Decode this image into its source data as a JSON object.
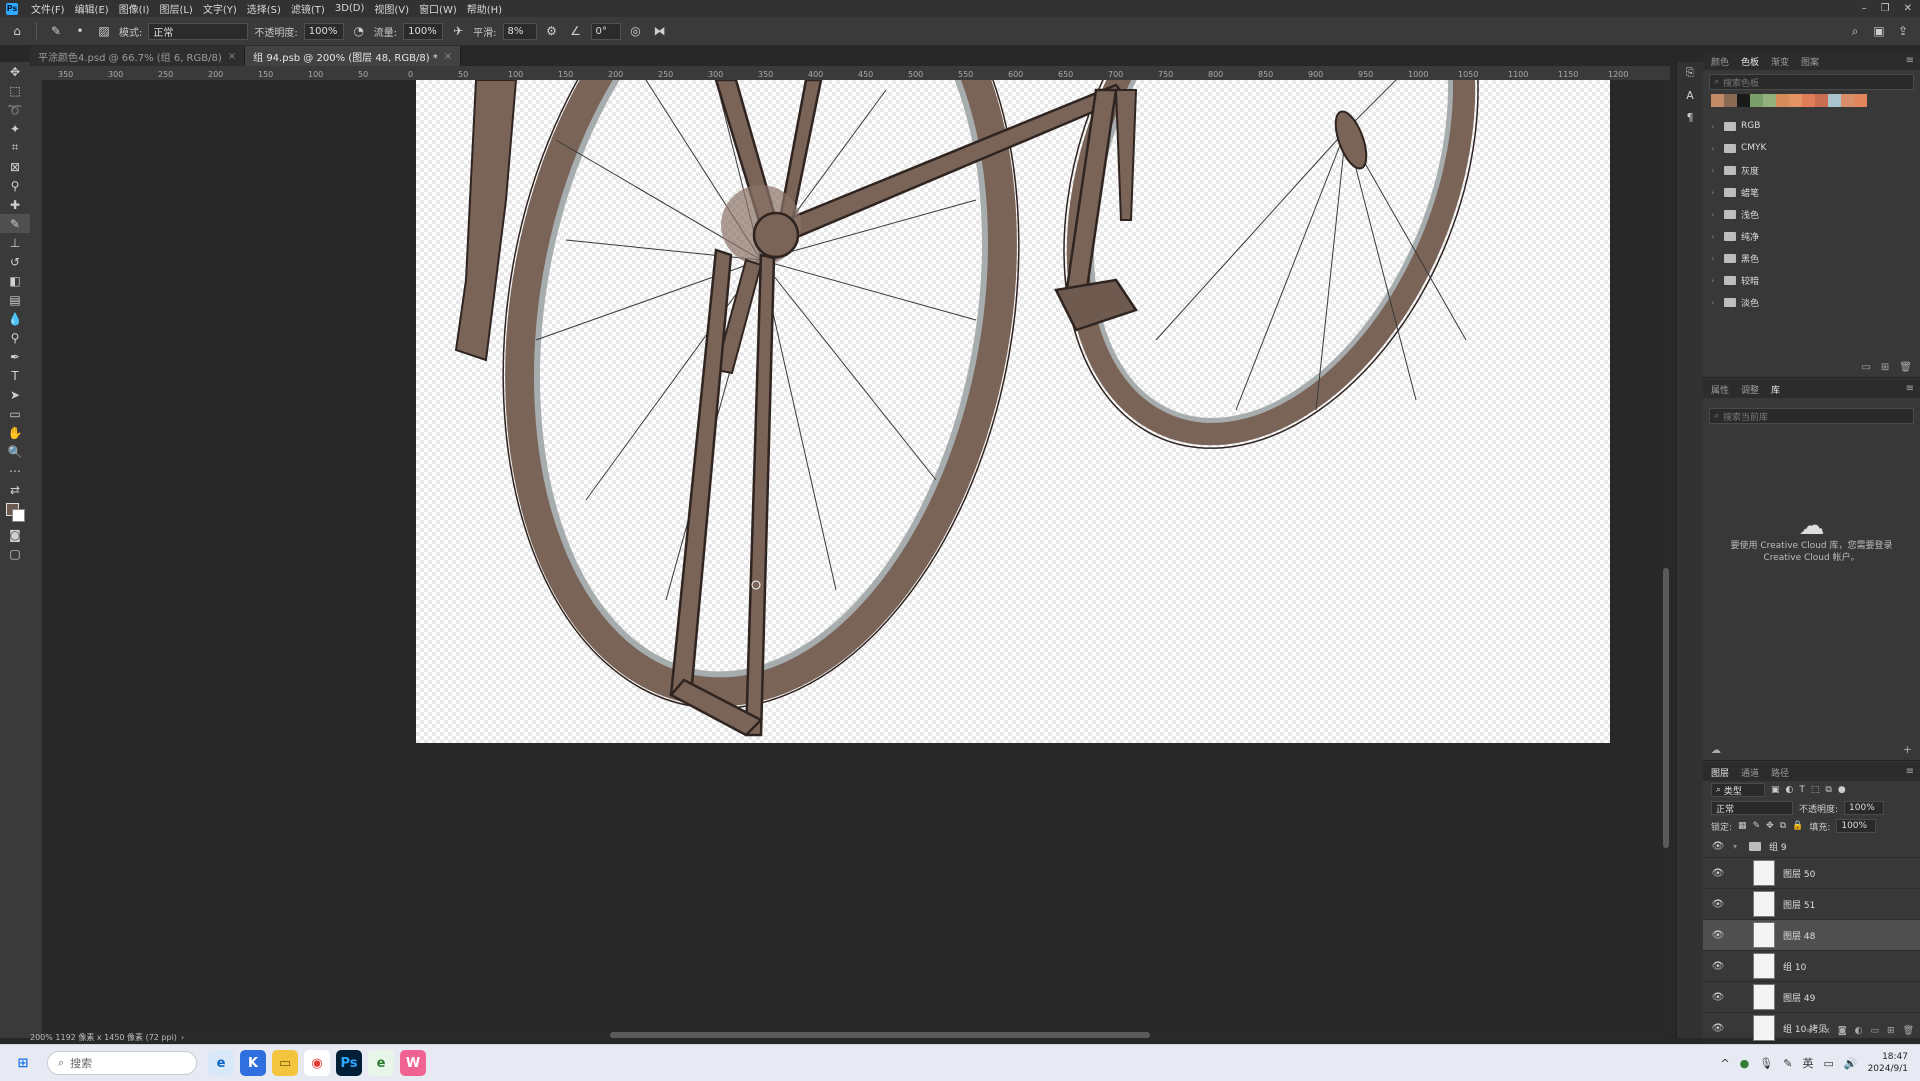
{
  "menubar": {
    "logo": "Ps",
    "items": [
      "文件(F)",
      "编辑(E)",
      "图像(I)",
      "图层(L)",
      "文字(Y)",
      "选择(S)",
      "滤镜(T)",
      "3D(D)",
      "视图(V)",
      "窗口(W)",
      "帮助(H)"
    ]
  },
  "options": {
    "mode_label": "模式:",
    "mode_value": "正常",
    "opacity_label": "不透明度:",
    "opacity_value": "100%",
    "flow_label": "流量:",
    "flow_value": "100%",
    "smooth_label": "平滑:",
    "smooth_value": "8%",
    "angle_value": "0°"
  },
  "tabs": [
    {
      "label": "平涂颜色4.psd @ 66.7% (组 6, RGB/8)",
      "close": "×"
    },
    {
      "label": "组 94.psb @ 200% (图层 48, RGB/8) *",
      "close": "×"
    }
  ],
  "ruler": {
    "top_ticks": [
      "350",
      "300",
      "250",
      "200",
      "150",
      "100",
      "50",
      "0",
      "50",
      "100",
      "150",
      "200",
      "250",
      "300",
      "350",
      "400",
      "450",
      "500",
      "550",
      "600",
      "650",
      "700",
      "750",
      "800",
      "850",
      "900",
      "950",
      "1000",
      "1050",
      "1100",
      "1150",
      "1200"
    ]
  },
  "status": {
    "text": "200%   1192 像素 x 1450 像素 (72 ppi)",
    "arrow": "›"
  },
  "color_panel": {
    "tabs": [
      "颜色",
      "色板",
      "渐变",
      "图案"
    ],
    "search_placeholder": "搜索色板",
    "swatches": [
      "#c28a66",
      "#8a6a52",
      "#1a1a1a",
      "#7b9e6b",
      "#93b07d",
      "#d78a5a",
      "#e49462",
      "#e07c58",
      "#c86c52",
      "#a9c4cc",
      "#d9906a",
      "#e0855e"
    ],
    "groups": [
      "RGB",
      "CMYK",
      "灰度",
      "蜡笔",
      "浅色",
      "纯净",
      "黑色",
      "较暗",
      "淡色"
    ]
  },
  "library_panel": {
    "tabs": [
      "属性",
      "调整",
      "库"
    ],
    "search_placeholder": "搜索当前库",
    "empty_line1": "要使用 Creative Cloud 库，您需要登录",
    "empty_line2": "Creative Cloud 帐户。"
  },
  "layers_panel": {
    "tabs": [
      "图层",
      "通道",
      "路径"
    ],
    "filter_label": "类型",
    "blend_mode": "正常",
    "opacity_label": "不透明度:",
    "opacity_value": "100%",
    "lock_label": "锁定:",
    "fill_label": "填充:",
    "fill_value": "100%",
    "group_name": "组 9",
    "layers": [
      {
        "name": "图层 50",
        "selected": false
      },
      {
        "name": "图层 51",
        "selected": false
      },
      {
        "name": "图层 48",
        "selected": true
      },
      {
        "name": "组 10",
        "selected": false
      },
      {
        "name": "图层 49",
        "selected": false
      },
      {
        "name": "组 10 拷贝",
        "selected": false
      }
    ]
  },
  "taskbar": {
    "search_placeholder": "搜索",
    "time": "18:47",
    "date": "2024/9/1",
    "ime": "英"
  },
  "colors": {
    "bike_fill": "#7a6458",
    "bike_stroke": "#2f2420",
    "rim_highlight": "#a7adae",
    "canvas_bg": "#282828",
    "panel_bg": "#383838"
  }
}
